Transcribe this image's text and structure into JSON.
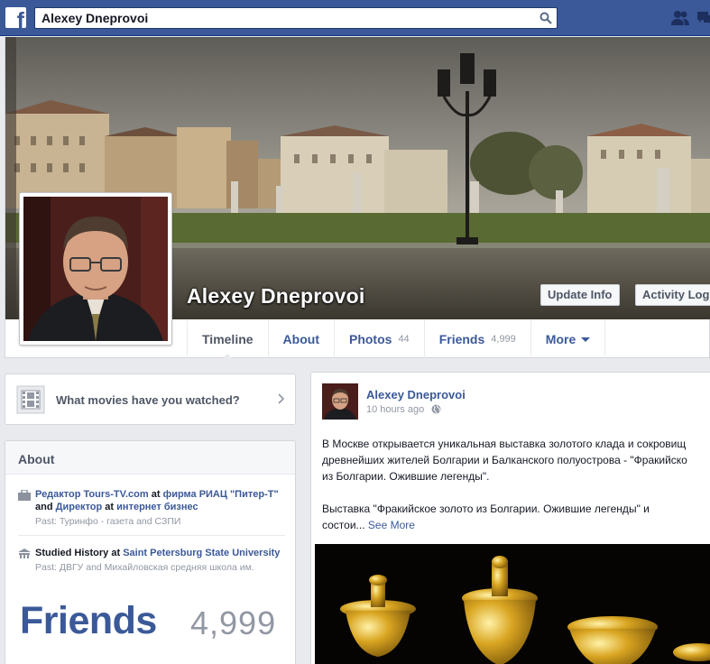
{
  "topbar": {
    "search_value": "Alexey Dneprovoi",
    "logo_letter": "f"
  },
  "cover": {
    "name": "Alexey Dneprovoi",
    "update_info_label": "Update Info",
    "activity_log_label": "Activity Log"
  },
  "tabs": [
    {
      "label": "Timeline",
      "count": ""
    },
    {
      "label": "About",
      "count": ""
    },
    {
      "label": "Photos",
      "count": "44"
    },
    {
      "label": "Friends",
      "count": "4,999"
    },
    {
      "label": "More",
      "count": ""
    }
  ],
  "movies": {
    "prompt": "What movies have you watched?"
  },
  "about": {
    "title": "About",
    "work": {
      "role1": "Редактор Tours-TV.com",
      "at1": " at ",
      "company1": "фирма РИАЦ \"Питер-Т\"",
      "and": " and ",
      "role2": "Директор",
      "at2": " at ",
      "company2": "интернет бизнес",
      "past": "Past: Туринфо - газета and СЗПИ"
    },
    "education": {
      "studied": "Studied History at ",
      "school": "Saint Petersburg State University",
      "past": "Past: ДВГУ and Михайловская средняя школа им."
    },
    "friends_title": "Friends",
    "friends_count": "4,999"
  },
  "post": {
    "author": "Alexey Dneprovoi",
    "time": "10 hours ago",
    "line1": "В Москве открывается уникальная выставка золотого клада и сокровищ",
    "line2": "древнейших жителей Болгарии и Балканского полуострова - \"Фракийско",
    "line3": "из Болгарии. Ожившие легенды\".",
    "line4": "Выставка \"Фракийское золото из Болгарии. Ожившие легенды\" и",
    "line5": "состои...",
    "see_more": "See More"
  },
  "colors": {
    "brand": "#3b5998",
    "background": "#e9eaed"
  }
}
